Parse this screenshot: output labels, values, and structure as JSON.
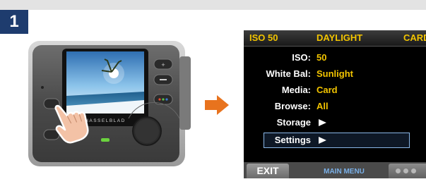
{
  "step": {
    "number": "1"
  },
  "camera": {
    "brand_text": "HASSELBLAD"
  },
  "lcd": {
    "status_bar": {
      "iso": "ISO 50",
      "white_balance": "DAYLIGHT",
      "storage": "CARD"
    },
    "menu": {
      "items": [
        {
          "label": "ISO:",
          "value": "50"
        },
        {
          "label": "White Bal:",
          "value": "Sunlight"
        },
        {
          "label": "Media:",
          "value": "Card"
        },
        {
          "label": "Browse:",
          "value": "All"
        },
        {
          "label": "Storage",
          "value": ""
        },
        {
          "label": "Settings",
          "value": ""
        }
      ],
      "selected_label": "Settings"
    },
    "footer": {
      "exit_label": "EXIT",
      "title": "MAIN MENU"
    }
  },
  "colors": {
    "badge": "#1e3c6e",
    "arrow": "#e8731e",
    "lcd_value": "#f2c400",
    "highlight_border": "#8ab8e8",
    "footer_title": "#7ab0e8"
  },
  "icons": {
    "step_badge": "number-badge",
    "arrow": "right-arrow-icon",
    "submenu": "right-triangle-icon",
    "more": "three-dots-icon"
  }
}
